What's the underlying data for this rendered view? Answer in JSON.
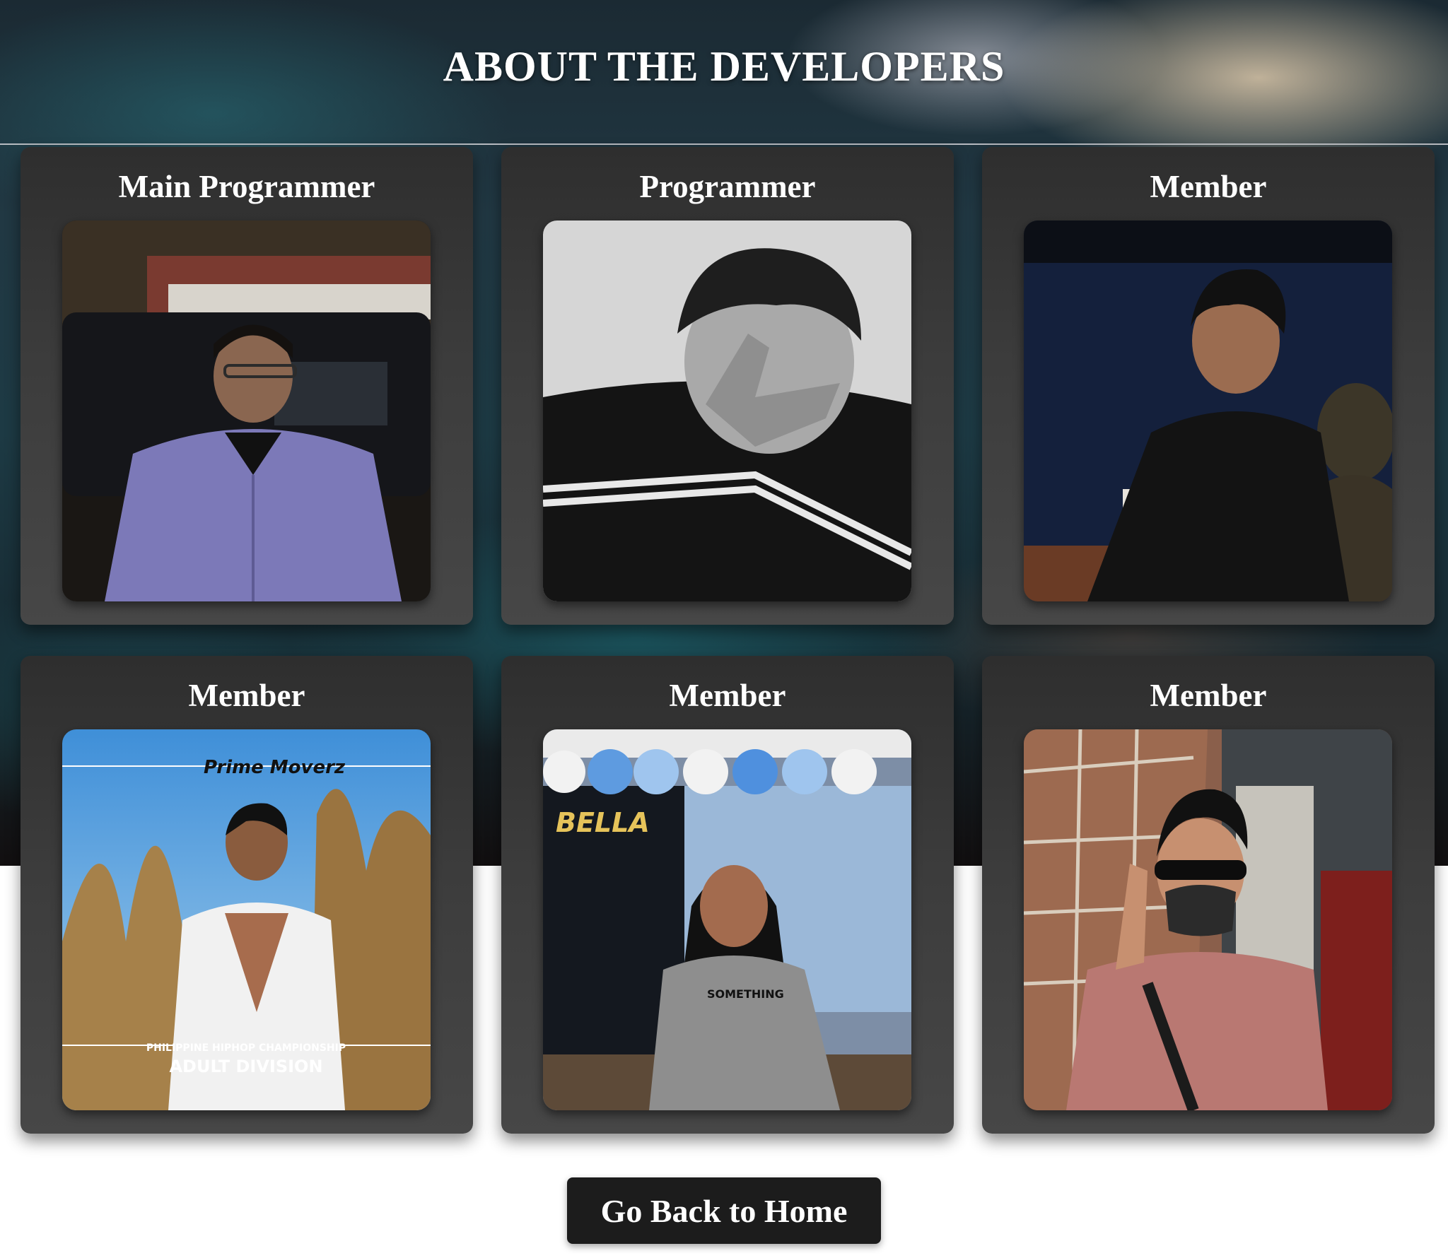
{
  "page": {
    "title": "ABOUT THE DEVELOPERS"
  },
  "developers": [
    {
      "role": "Main Programmer",
      "photo_icon": "developer-photo"
    },
    {
      "role": "Programmer",
      "photo_icon": "developer-photo"
    },
    {
      "role": "Member",
      "photo_icon": "developer-photo"
    },
    {
      "role": "Member",
      "photo_icon": "developer-photo"
    },
    {
      "role": "Member",
      "photo_icon": "developer-photo"
    },
    {
      "role": "Member",
      "photo_icon": "developer-photo"
    }
  ],
  "photo_text": {
    "poster_brand": "Prime Moverz",
    "poster_event": "PHILIPPINE HIPHOP CHAMPIONSHIP",
    "poster_division": "ADULT DIVISION",
    "banner_name": "BELLA",
    "shirt_text": "SOMETHING"
  },
  "actions": {
    "home_label": "Go Back to Home"
  },
  "colors": {
    "card_bg": "#3a3a3a",
    "button_bg": "#1c1c1c",
    "title_text": "#ffffff"
  }
}
